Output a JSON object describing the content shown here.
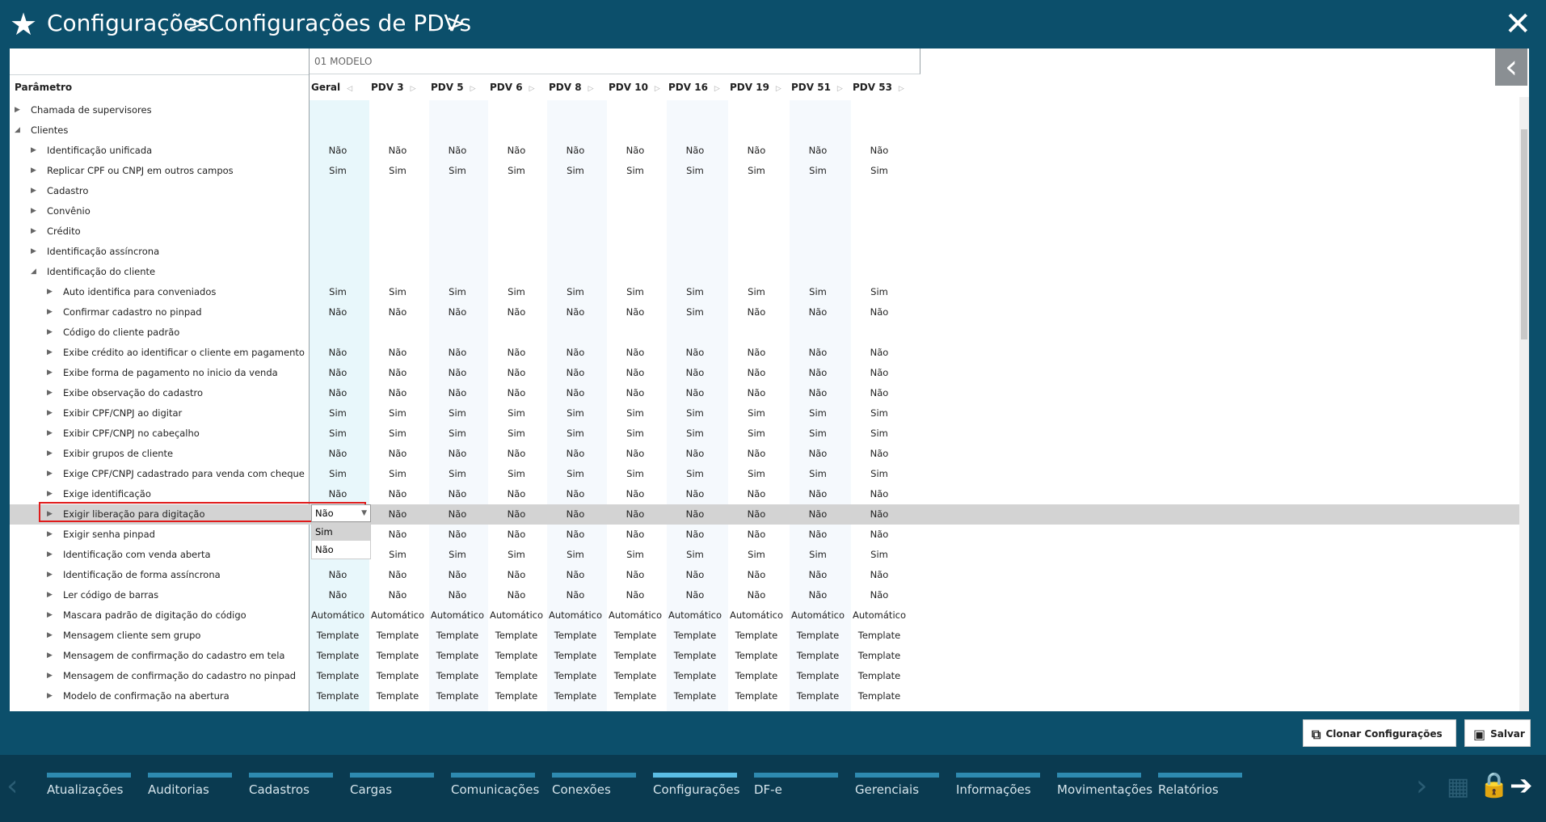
{
  "titlebar": {
    "crumb1": "Configurações",
    "sep1": ">",
    "crumb2": "Configurações de PDVs",
    "sep2": ">",
    "close_icon": "close-icon",
    "star_icon": "star-icon"
  },
  "grid": {
    "modelo_label": "01 MODELO",
    "param_header": "Parâmetro",
    "columns": [
      "Geral",
      "PDV 3",
      "PDV 5",
      "PDV 6",
      "PDV 8",
      "PDV 10",
      "PDV 16",
      "PDV 19",
      "PDV 51",
      "PDV 53"
    ],
    "rows": [
      {
        "label": "Chamada de supervisores",
        "level": 0,
        "expanded": false,
        "values": []
      },
      {
        "label": "Clientes",
        "level": 0,
        "expanded": true,
        "values": []
      },
      {
        "label": "Identificação unificada",
        "level": 1,
        "expanded": false,
        "values": [
          "Não",
          "Não",
          "Não",
          "Não",
          "Não",
          "Não",
          "Não",
          "Não",
          "Não",
          "Não"
        ]
      },
      {
        "label": "Replicar CPF ou CNPJ em outros campos",
        "level": 1,
        "expanded": false,
        "values": [
          "Sim",
          "Sim",
          "Sim",
          "Sim",
          "Sim",
          "Sim",
          "Sim",
          "Sim",
          "Sim",
          "Sim"
        ]
      },
      {
        "label": "Cadastro",
        "level": 1,
        "expanded": false,
        "values": []
      },
      {
        "label": "Convênio",
        "level": 1,
        "expanded": false,
        "values": []
      },
      {
        "label": "Crédito",
        "level": 1,
        "expanded": false,
        "values": []
      },
      {
        "label": "Identificação assíncrona",
        "level": 1,
        "expanded": false,
        "values": []
      },
      {
        "label": "Identificação do cliente",
        "level": 1,
        "expanded": true,
        "values": []
      },
      {
        "label": "Auto identifica para conveniados",
        "level": 2,
        "expanded": false,
        "values": [
          "Sim",
          "Sim",
          "Sim",
          "Sim",
          "Sim",
          "Sim",
          "Sim",
          "Sim",
          "Sim",
          "Sim"
        ]
      },
      {
        "label": "Confirmar cadastro no pinpad",
        "level": 2,
        "expanded": false,
        "values": [
          "Não",
          "Não",
          "Não",
          "Não",
          "Não",
          "Não",
          "Sim",
          "Não",
          "Não",
          "Não"
        ]
      },
      {
        "label": "Código do cliente padrão",
        "level": 2,
        "expanded": false,
        "values": []
      },
      {
        "label": "Exibe crédito ao identificar o cliente em pagamento",
        "level": 2,
        "expanded": false,
        "values": [
          "Não",
          "Não",
          "Não",
          "Não",
          "Não",
          "Não",
          "Não",
          "Não",
          "Não",
          "Não"
        ]
      },
      {
        "label": "Exibe forma de pagamento no inicio da venda",
        "level": 2,
        "expanded": false,
        "values": [
          "Não",
          "Não",
          "Não",
          "Não",
          "Não",
          "Não",
          "Não",
          "Não",
          "Não",
          "Não"
        ]
      },
      {
        "label": "Exibe observação do cadastro",
        "level": 2,
        "expanded": false,
        "values": [
          "Não",
          "Não",
          "Não",
          "Não",
          "Não",
          "Não",
          "Não",
          "Não",
          "Não",
          "Não"
        ]
      },
      {
        "label": "Exibir CPF/CNPJ ao digitar",
        "level": 2,
        "expanded": false,
        "values": [
          "Sim",
          "Sim",
          "Sim",
          "Sim",
          "Sim",
          "Sim",
          "Sim",
          "Sim",
          "Sim",
          "Sim"
        ]
      },
      {
        "label": "Exibir CPF/CNPJ no cabeçalho",
        "level": 2,
        "expanded": false,
        "values": [
          "Sim",
          "Sim",
          "Sim",
          "Sim",
          "Sim",
          "Sim",
          "Sim",
          "Sim",
          "Sim",
          "Sim"
        ]
      },
      {
        "label": "Exibir grupos de cliente",
        "level": 2,
        "expanded": false,
        "values": [
          "Não",
          "Não",
          "Não",
          "Não",
          "Não",
          "Não",
          "Não",
          "Não",
          "Não",
          "Não"
        ]
      },
      {
        "label": "Exige CPF/CNPJ cadastrado para venda com cheque",
        "level": 2,
        "expanded": false,
        "values": [
          "Sim",
          "Sim",
          "Sim",
          "Sim",
          "Sim",
          "Sim",
          "Sim",
          "Sim",
          "Sim",
          "Sim"
        ]
      },
      {
        "label": "Exige identificação",
        "level": 2,
        "expanded": false,
        "values": [
          "Não",
          "Não",
          "Não",
          "Não",
          "Não",
          "Não",
          "Não",
          "Não",
          "Não",
          "Não"
        ]
      },
      {
        "label": "Exigir liberação para digitação",
        "level": 2,
        "expanded": false,
        "selected": true,
        "values": [
          "",
          "Não",
          "Não",
          "Não",
          "Não",
          "Não",
          "Não",
          "Não",
          "Não",
          "Não"
        ]
      },
      {
        "label": "Exigir senha pinpad",
        "level": 2,
        "expanded": false,
        "values": [
          "",
          "Não",
          "Não",
          "Não",
          "Não",
          "Não",
          "Não",
          "Não",
          "Não",
          "Não"
        ]
      },
      {
        "label": "Identificação com venda aberta",
        "level": 2,
        "expanded": false,
        "values": [
          "",
          "Sim",
          "Sim",
          "Sim",
          "Sim",
          "Sim",
          "Sim",
          "Sim",
          "Sim",
          "Sim"
        ]
      },
      {
        "label": "Identificação de forma assíncrona",
        "level": 2,
        "expanded": false,
        "values": [
          "Não",
          "Não",
          "Não",
          "Não",
          "Não",
          "Não",
          "Não",
          "Não",
          "Não",
          "Não"
        ]
      },
      {
        "label": "Ler código de barras",
        "level": 2,
        "expanded": false,
        "values": [
          "Não",
          "Não",
          "Não",
          "Não",
          "Não",
          "Não",
          "Não",
          "Não",
          "Não",
          "Não"
        ]
      },
      {
        "label": "Mascara padrão de digitação do código",
        "level": 2,
        "expanded": false,
        "values": [
          "Automático",
          "Automático",
          "Automático",
          "Automático",
          "Automático",
          "Automático",
          "Automático",
          "Automático",
          "Automático",
          "Automático"
        ]
      },
      {
        "label": "Mensagem cliente sem grupo",
        "level": 2,
        "expanded": false,
        "values": [
          "Template",
          "Template",
          "Template",
          "Template",
          "Template",
          "Template",
          "Template",
          "Template",
          "Template",
          "Template"
        ]
      },
      {
        "label": "Mensagem de confirmação do cadastro em tela",
        "level": 2,
        "expanded": false,
        "values": [
          "Template",
          "Template",
          "Template",
          "Template",
          "Template",
          "Template",
          "Template",
          "Template",
          "Template",
          "Template"
        ]
      },
      {
        "label": "Mensagem de confirmação do cadastro no pinpad",
        "level": 2,
        "expanded": false,
        "values": [
          "Template",
          "Template",
          "Template",
          "Template",
          "Template",
          "Template",
          "Template",
          "Template",
          "Template",
          "Template"
        ]
      },
      {
        "label": "Modelo de confirmação na abertura",
        "level": 2,
        "expanded": false,
        "values": [
          "Template",
          "Template",
          "Template",
          "Template",
          "Template",
          "Template",
          "Template",
          "Template",
          "Template",
          "Template"
        ]
      }
    ],
    "editor": {
      "value": "Não",
      "options": [
        "Sim",
        "Não"
      ],
      "hovered": "Sim"
    }
  },
  "actions": {
    "clone_label": "Clonar Configurações",
    "save_label": "Salvar"
  },
  "footer": {
    "nav": [
      "Atualizações",
      "Auditorias",
      "Cadastros",
      "Cargas",
      "Comunicações",
      "Conexões",
      "Configurações",
      "DF-e",
      "Gerenciais",
      "Informações",
      "Movimentações",
      "Relatórios"
    ],
    "active": "Configurações"
  },
  "colors": {
    "header_bg": "#0c4f6b",
    "footer_bg": "#0a3a50",
    "nav_bar": "#2e8ab0",
    "nav_bar_active": "#5bbde4",
    "highlight_border": "#e01b1b",
    "selected_row": "#d3d3d3"
  }
}
